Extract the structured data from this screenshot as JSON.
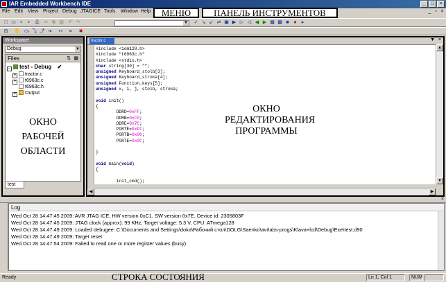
{
  "window": {
    "title": "IAR Embedded Workbench IDE"
  },
  "menu": {
    "items": [
      "File",
      "Edit",
      "View",
      "Project",
      "Debug",
      "JTAGICE",
      "Tools",
      "Window",
      "Help"
    ]
  },
  "annotations": {
    "menu": "МЕНЮ",
    "toolbar": "ПАНЕЛЬ ИНСТРУМЕНТОВ",
    "workspace": [
      "ОКНО",
      "РАБОЧЕЙ",
      "ОБЛАСТИ"
    ],
    "editor": [
      "ОКНО",
      "РЕДАКТИРОВАНИЯ",
      "ПРОГРАММЫ"
    ],
    "statusbar": "СТРОКА СОСТОЯНИЯ"
  },
  "workspace": {
    "title": "Workspace",
    "config": "Debug",
    "files_header": "Files",
    "tree": [
      {
        "label": "test - Debug",
        "kind": "project",
        "checked": true
      },
      {
        "label": "tractor.c",
        "kind": "file"
      },
      {
        "label": "t6963c.c",
        "kind": "file"
      },
      {
        "label": "t6963c.h",
        "kind": "file"
      },
      {
        "label": "Output",
        "kind": "folder"
      }
    ],
    "tab": "test"
  },
  "editor": {
    "tab": "tractor.c",
    "code": [
      "#include <iom128.h>",
      "#include \"t6963c.h\"",
      "#include <stdio.h>",
      "char string[30] = \"\";",
      "unsigned Keyboard_stolb[3];",
      "unsigned Keyboard_stroka[4];",
      "unsigned Function_keys[5];",
      "unsigned x, i, j, stolb, stroka;",
      "",
      "void init()",
      "{",
      "        DDRD=0xFF;",
      "        DDRB=0xC0;",
      "        DDRE=0x7C;",
      "        PORTE=0xFF;",
      "        PORTB=0x00;",
      "        PORTE=0x0C;",
      "",
      "}",
      "",
      "void main(void)",
      "{",
      "",
      "        init_cmd();"
    ]
  },
  "log": {
    "header": "Log",
    "lines": [
      "Wed Oct 28 14:47:45 2009: AVR JTAG ICE, HW version 0xC1, SW version 0x7E, Device id: 2305803F",
      "Wed Oct 28 14:47:45 2009: JTAG clock (approx): 99 KHz, Target voltage: 5.3 V, CPU: ATmega128",
      "Wed Oct 28 14:47:49 2009: Loaded debugee: C:\\Documents and Settings\\doka\\Рабочий стол\\DOLG\\Saenko\\avrlabs-progs\\Klava+lcd\\Debug\\Exe\\test.d90",
      "Wed Oct 28 14:47:49 2009: Target reset",
      "Wed Oct 28 14:47:54 2009: Failed to read one or more register values (busy)."
    ]
  },
  "status": {
    "left": "Ready",
    "position": "Ln 1, Col 1",
    "num": "NUM"
  }
}
